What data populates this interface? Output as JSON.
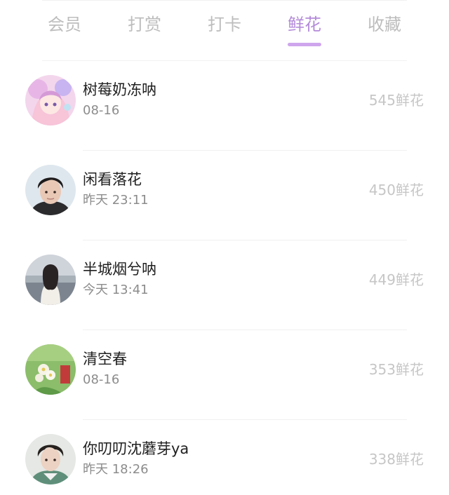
{
  "tabs": [
    {
      "label": "会员",
      "active": false
    },
    {
      "label": "打赏",
      "active": false
    },
    {
      "label": "打卡",
      "active": false
    },
    {
      "label": "鲜花",
      "active": true
    },
    {
      "label": "收藏",
      "active": false
    }
  ],
  "colors": {
    "active_tab": "#b48bd9",
    "inactive_tab": "#bdbdbd",
    "indicator": "#cfa6ee",
    "name_text": "#1f1f1f",
    "time_text": "#8c8c8c",
    "amount_text": "#c6c6c6"
  },
  "list": [
    {
      "name": "树莓奶冻呐",
      "time": "08-16",
      "amount": "545鲜花",
      "avatar": "anime-girl-pink-avatar"
    },
    {
      "name": "闲看落花",
      "time": "昨天 23:11",
      "amount": "450鲜花",
      "avatar": "young-man-avatar"
    },
    {
      "name": "半城烟兮呐",
      "time": "今天 13:41",
      "amount": "449鲜花",
      "avatar": "girl-back-view-avatar"
    },
    {
      "name": "清空春",
      "time": "08-16",
      "amount": "353鲜花",
      "avatar": "flowers-green-avatar"
    },
    {
      "name": "你叨叨沈蘑芽ya",
      "time": "昨天 18:26",
      "amount": "338鲜花",
      "avatar": "young-man-curly-avatar"
    }
  ]
}
